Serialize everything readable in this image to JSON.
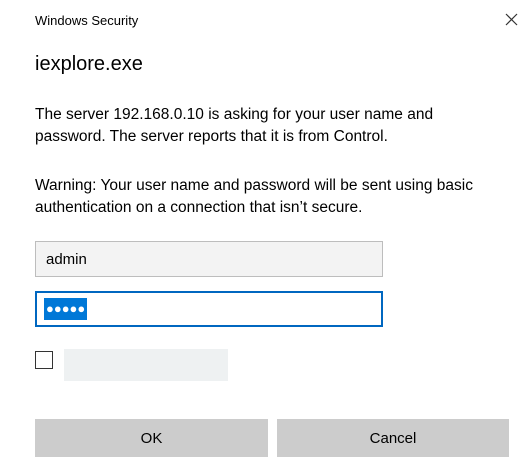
{
  "window": {
    "title": "Windows Security",
    "close_icon": "close-icon"
  },
  "dialog": {
    "app_name": "iexplore.exe",
    "message_server": "The server 192.168.0.10 is asking for your user name and password. The server reports that it is from Control.",
    "message_warning": "Warning: Your user name and password will be sent using basic authentication on a connection that isn’t secure.",
    "username_value": "admin",
    "password_mask": "●●●●●",
    "remember_label": "",
    "ok_label": "OK",
    "cancel_label": "Cancel"
  },
  "colors": {
    "accent": "#0067c0",
    "selection": "#0078d7",
    "button_bg": "#cccccc"
  }
}
